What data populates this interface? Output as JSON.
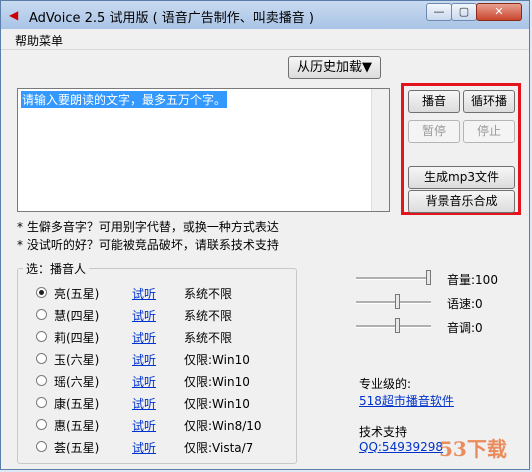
{
  "window": {
    "title": "AdVoice 2.5 试用版 ( 语音广告制作、叫卖播音 )"
  },
  "titlebar_buttons": {
    "minimize": "—",
    "maximize": "▢",
    "close": "✕"
  },
  "menu": {
    "help": "帮助菜单"
  },
  "history_button": "从历史加载▼",
  "textarea": {
    "value": "请输入要朗读的文字，最多五万个字。"
  },
  "actions": {
    "play": "播音",
    "loop": "循环播",
    "pause": "暂停",
    "stop": "停止",
    "gen_mp3": "生成mp3文件",
    "bgm_mix": "背景音乐合成"
  },
  "hints": [
    "* 生僻多音字？可用别字代替，或换一种方式表达",
    "* 没试听的好？可能被竞品破坏，请联系技术支持"
  ],
  "voices_group": {
    "label": "选：播音人",
    "try_label": "试听",
    "voices": [
      {
        "name": "亮(五星)",
        "limit": "系统不限",
        "checked": true
      },
      {
        "name": "慧(四星)",
        "limit": "系统不限",
        "checked": false
      },
      {
        "name": "莉(四星)",
        "limit": "系统不限",
        "checked": false
      },
      {
        "name": "玉(六星)",
        "limit": "仅限:Win10",
        "checked": false
      },
      {
        "name": "瑶(六星)",
        "limit": "仅限:Win10",
        "checked": false
      },
      {
        "name": "康(五星)",
        "limit": "仅限:Win10",
        "checked": false
      },
      {
        "name": "惠(五星)",
        "limit": "仅限:Win8/10",
        "checked": false
      },
      {
        "name": "荟(五星)",
        "limit": "仅限:Vista/7",
        "checked": false
      }
    ]
  },
  "sliders": [
    {
      "label": "音量:100",
      "level": 1.0
    },
    {
      "label": "语速:0",
      "level": 0.55
    },
    {
      "label": "音调:0",
      "level": 0.55
    }
  ],
  "pro": {
    "label": "专业级的:",
    "link": "518超市播音软件"
  },
  "support": {
    "label": "技术支持",
    "link": "QQ:54939298"
  },
  "watermark": "53下载"
}
